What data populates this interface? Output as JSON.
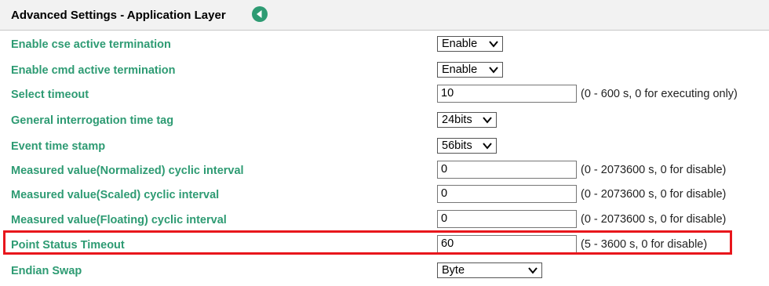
{
  "header": {
    "title": "Advanced Settings - Application Layer",
    "back_icon": "circle-back-arrow-icon",
    "back_icon_color": "#2e9b73"
  },
  "colors": {
    "label": "#2e9b73",
    "highlight": "#e8161c"
  },
  "rows": [
    {
      "label": "Enable cse active termination",
      "type": "select",
      "value": "Enable"
    },
    {
      "label": "Enable cmd active termination",
      "type": "select",
      "value": "Enable"
    },
    {
      "label": "Select timeout",
      "type": "input",
      "value": "10",
      "hint": "(0 - 600 s, 0 for executing only)"
    },
    {
      "label": "General interrogation time tag",
      "type": "select",
      "value": "24bits"
    },
    {
      "label": "Event time stamp",
      "type": "select",
      "value": "56bits"
    },
    {
      "label": "Measured value(Normalized) cyclic interval",
      "type": "input",
      "value": "0",
      "hint": "(0 - 2073600 s, 0 for disable)"
    },
    {
      "label": "Measured value(Scaled) cyclic interval",
      "type": "input",
      "value": "0",
      "hint": "(0 - 2073600 s, 0 for disable)"
    },
    {
      "label": "Measured value(Floating) cyclic interval",
      "type": "input",
      "value": "0",
      "hint": "(0 - 2073600 s, 0 for disable)"
    },
    {
      "label": "Point Status Timeout",
      "type": "input",
      "value": "60",
      "hint": "(5 - 3600 s, 0 for disable)"
    },
    {
      "label": "Endian Swap",
      "type": "select",
      "value": "Byte"
    }
  ]
}
